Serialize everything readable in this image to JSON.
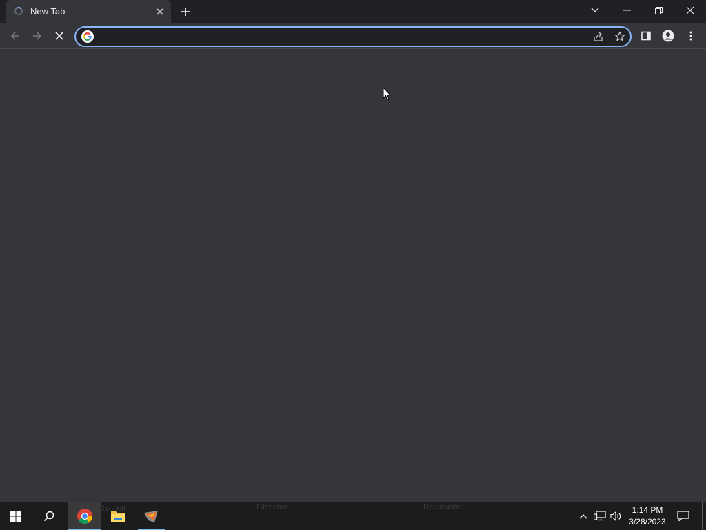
{
  "browser": {
    "tab": {
      "title": "New Tab"
    },
    "omnibox": {
      "value": "",
      "placeholder": ""
    }
  },
  "taskbar": {
    "apps": [
      {
        "name": "chrome-icon",
        "active": true
      },
      {
        "name": "file-explorer-icon",
        "active": false
      },
      {
        "name": "app-icon",
        "active": false
      }
    ],
    "ghost_labels": [
      "Jannett",
      "Filename",
      "Datamaster"
    ],
    "clock": {
      "time": "1:14 PM",
      "date": "3/28/2023"
    }
  },
  "colors": {
    "accent": "#8ab4f8",
    "tabstrip": "#202124",
    "toolbar": "#35363a",
    "taskbar": "#1c1c1c"
  }
}
